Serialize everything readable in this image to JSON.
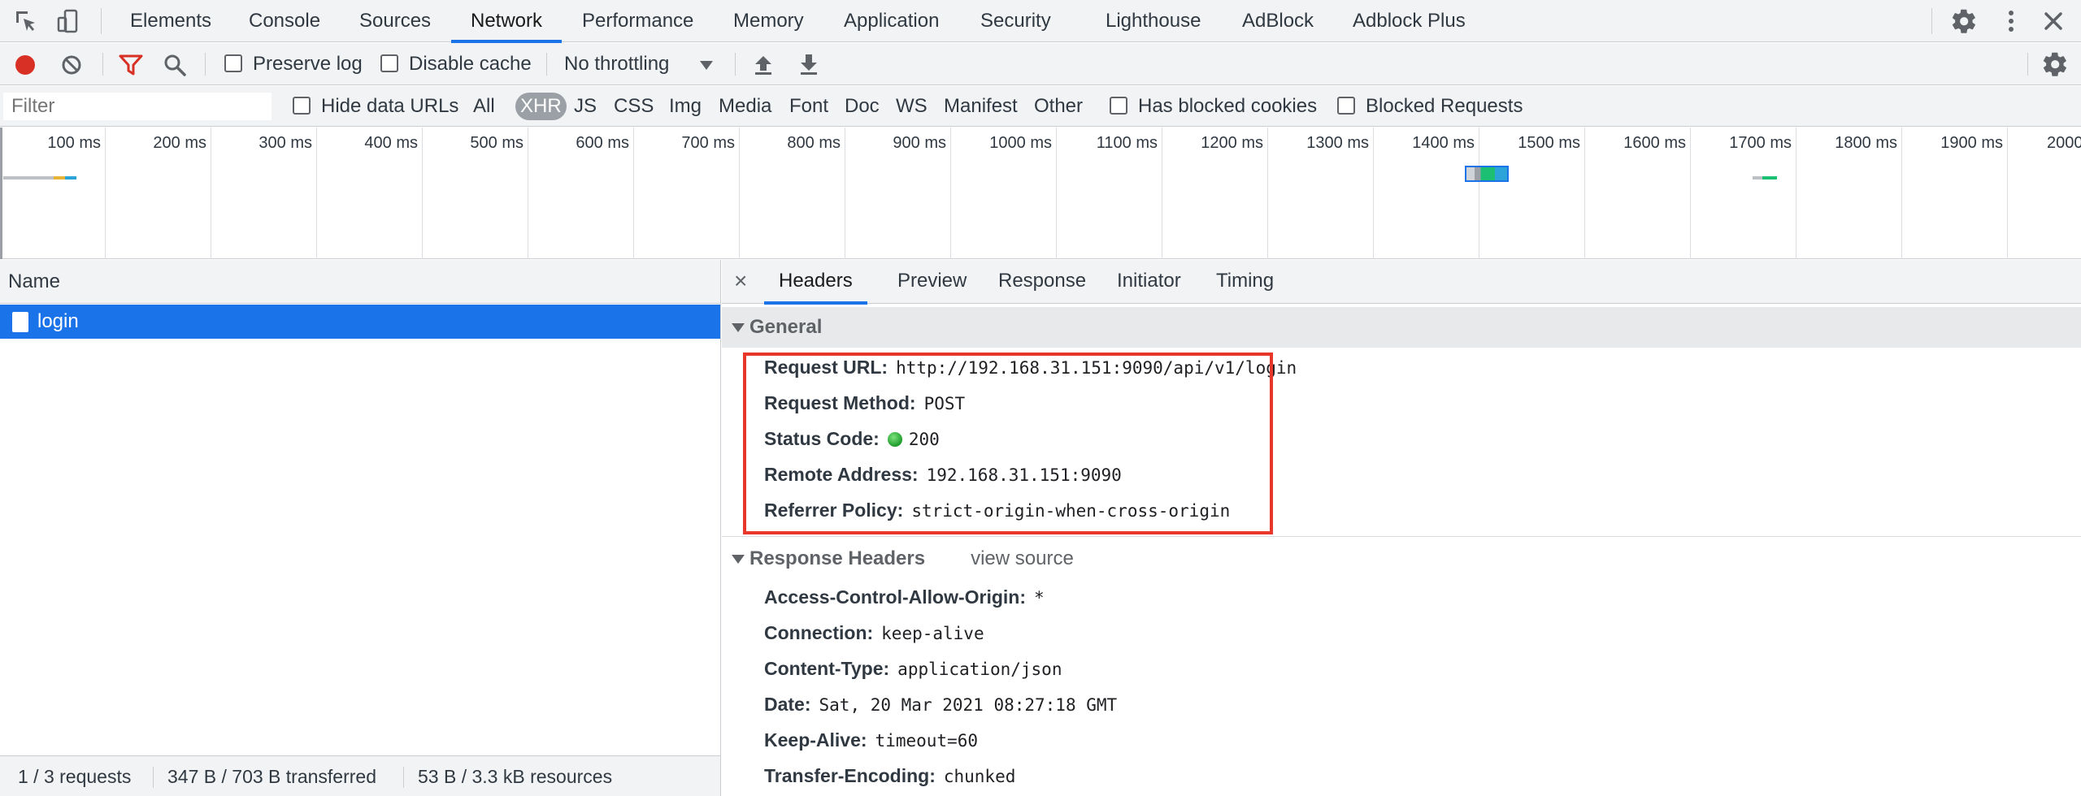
{
  "tabbar": {
    "tabs": [
      "Elements",
      "Console",
      "Sources",
      "Network",
      "Performance",
      "Memory",
      "Application",
      "Security",
      "Lighthouse",
      "AdBlock",
      "Adblock Plus"
    ],
    "active": "Network"
  },
  "toolbar": {
    "preserve_log": "Preserve log",
    "disable_cache": "Disable cache",
    "throttling": "No throttling"
  },
  "filterbar": {
    "filter_placeholder": "Filter",
    "hide_data_urls": "Hide data URLs",
    "types": [
      "All",
      "XHR",
      "JS",
      "CSS",
      "Img",
      "Media",
      "Font",
      "Doc",
      "WS",
      "Manifest",
      "Other"
    ],
    "active_type": "XHR",
    "has_blocked_cookies": "Has blocked cookies",
    "blocked_requests": "Blocked Requests"
  },
  "overview": {
    "ticks": [
      "100 ms",
      "200 ms",
      "300 ms",
      "400 ms",
      "500 ms",
      "600 ms",
      "700 ms",
      "800 ms",
      "900 ms",
      "1000 ms",
      "1100 ms",
      "1200 ms",
      "1300 ms",
      "1400 ms",
      "1500 ms",
      "1600 ms",
      "1700 ms",
      "1800 ms",
      "1900 ms",
      "2000 ms"
    ]
  },
  "leftpane": {
    "name_header": "Name",
    "request_name": "login",
    "status": {
      "requests": "1 / 3 requests",
      "transferred": "347 B / 703 B transferred",
      "resources": "53 B / 3.3 kB resources"
    }
  },
  "detail": {
    "close": "×",
    "tabs": [
      "Headers",
      "Preview",
      "Response",
      "Initiator",
      "Timing"
    ],
    "active_tab": "Headers",
    "general": {
      "title": "General",
      "request_url_key": "Request URL:",
      "request_url": "http://192.168.31.151:9090/api/v1/login",
      "request_method_key": "Request Method:",
      "request_method": "POST",
      "status_code_key": "Status Code:",
      "status_code": "200",
      "remote_address_key": "Remote Address:",
      "remote_address": "192.168.31.151:9090",
      "referrer_policy_key": "Referrer Policy:",
      "referrer_policy": "strict-origin-when-cross-origin"
    },
    "response_headers": {
      "title": "Response Headers",
      "view_source": "view source",
      "rows": [
        {
          "key": "Access-Control-Allow-Origin:",
          "value": "*"
        },
        {
          "key": "Connection:",
          "value": "keep-alive"
        },
        {
          "key": "Content-Type:",
          "value": "application/json"
        },
        {
          "key": "Date:",
          "value": "Sat, 20 Mar 2021 08:27:18 GMT"
        },
        {
          "key": "Keep-Alive:",
          "value": "timeout=60"
        },
        {
          "key": "Transfer-Encoding:",
          "value": "chunked"
        }
      ]
    }
  },
  "colors": {
    "accent": "#1a73e8",
    "record": "#d93025",
    "highlight_box": "#e8362b",
    "status_ok": "#1e9c2a"
  }
}
